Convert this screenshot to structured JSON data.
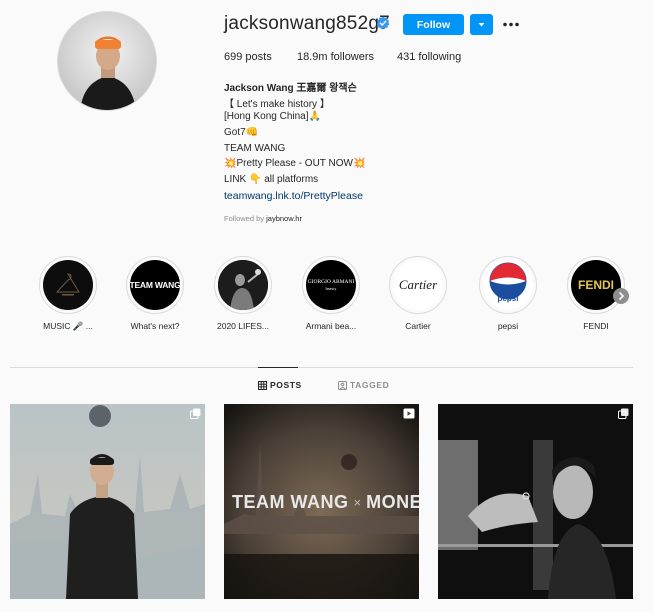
{
  "profile": {
    "username": "jacksonwang852g7",
    "follow_label": "Follow",
    "stats": {
      "posts": "699 posts",
      "followers": "18.9m followers",
      "following": "431 following"
    },
    "bio": {
      "name": "Jackson Wang 王嘉爾 왕잭슨",
      "lines": [
        "【 Let's make history 】",
        "[Hong Kong China]🙏",
        "Got7👊",
        "TEAM WANG",
        "💥Pretty Please - OUT NOW💥",
        "LINK 👇 all platforms"
      ],
      "link": "teamwang.lnk.to/PrettyPlease"
    },
    "followed_by_prefix": "Followed by ",
    "followed_by_user": "jaybnow.hr"
  },
  "highlights": [
    {
      "label": "MUSIC 🎤 ...",
      "icon": "music-highlight"
    },
    {
      "label": "What's next?",
      "cover_text": "TEAM WANG"
    },
    {
      "label": "2020 LIFES..."
    },
    {
      "label": "Armani bea...",
      "cover_text": "GIORGIO ARMANI",
      "cover_sub": "beauty"
    },
    {
      "label": "Cartier",
      "cover_text": "Cartier"
    },
    {
      "label": "pepsi",
      "cover_text": "pepsi"
    },
    {
      "label": "FENDI",
      "cover_text": "FENDI"
    }
  ],
  "tabs": [
    {
      "label": "POSTS",
      "icon": "grid-icon",
      "active": true
    },
    {
      "label": "TAGGED",
      "icon": "tag-icon",
      "active": false
    }
  ],
  "posts": [
    {
      "type": "carousel",
      "icon": "carousel-icon"
    },
    {
      "type": "video",
      "icon": "video-icon",
      "overlay_text_left": "TEAM WANG",
      "overlay_x": "×",
      "overlay_text_right": "MONET"
    },
    {
      "type": "carousel",
      "icon": "carousel-icon"
    }
  ],
  "colors": {
    "accent": "#0095f6",
    "link": "#00376b",
    "muted": "#8e8e8e",
    "border": "#dbdbdb",
    "background": "#fafafa"
  }
}
